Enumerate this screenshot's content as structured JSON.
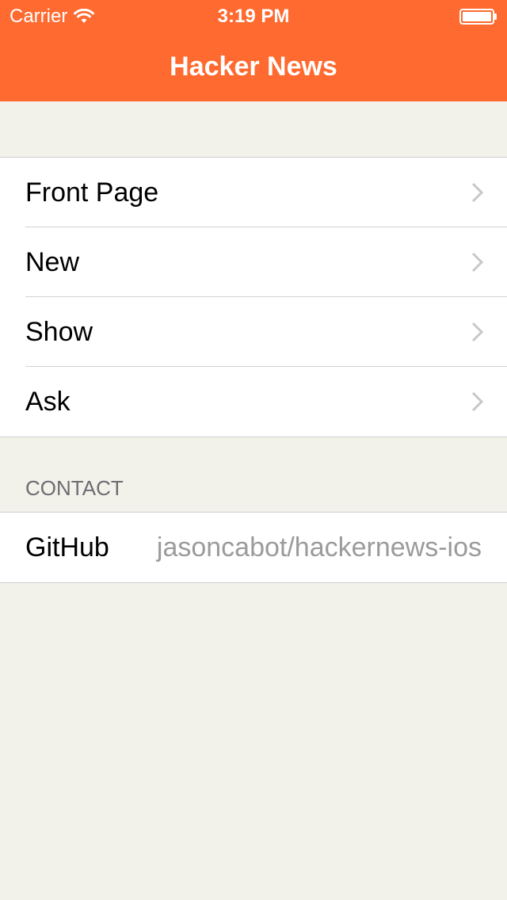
{
  "status_bar": {
    "carrier": "Carrier",
    "time": "3:19 PM",
    "wifi_icon": "wifi-icon",
    "battery_icon": "battery-icon"
  },
  "nav": {
    "title": "Hacker News"
  },
  "menu": {
    "items": [
      {
        "label": "Front Page",
        "icon": "chevron-right-icon"
      },
      {
        "label": "New",
        "icon": "chevron-right-icon"
      },
      {
        "label": "Show",
        "icon": "chevron-right-icon"
      },
      {
        "label": "Ask",
        "icon": "chevron-right-icon"
      }
    ]
  },
  "contact": {
    "header": "CONTACT",
    "github": {
      "label": "GitHub",
      "value": "jasoncabot/hackernews-ios"
    }
  },
  "colors": {
    "header_bg": "#fe6a2f",
    "page_bg": "#f2f1ea",
    "chevron": "#c7c7cc",
    "detail_text": "#9b9b9b"
  }
}
